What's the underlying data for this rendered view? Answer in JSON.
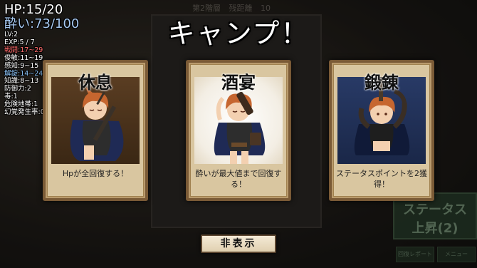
{
  "background": {
    "floor_label": "第2階層",
    "distance_label": "残距離",
    "distance_value": "10",
    "status_up_line1": "ステータス",
    "status_up_line2": "上昇(2)",
    "small_btn_1": "回復レポート",
    "small_btn_2": "メニュー"
  },
  "hud": {
    "hp": "HP:15/20",
    "drunk": "酔い:73/100",
    "lv": "LV:2",
    "exp": "EXP:5 / 7",
    "combat": "戦闘:17~29",
    "dodge": "俊敏:11~19",
    "perception": "感知:9~15",
    "unlock": "解錠:14~24",
    "knowledge": "知識:8~13",
    "defense": "防御力:2",
    "poison": "毒:1",
    "danger_zone": "危険地帯:1",
    "hallucination": "幻覚発生率:0%"
  },
  "title": "キャンプ！",
  "cards": [
    {
      "title": "休息",
      "desc": "Hpが全回復する！"
    },
    {
      "title": "酒宴",
      "desc": "酔いが最大値まで回復する！"
    },
    {
      "title": "鍛錬",
      "desc": "ステータスポイントを2獲得！"
    }
  ],
  "hide_button": "非表示",
  "colors": {
    "card_bg": "#d9c6a0",
    "card_border": "#7a5a36",
    "hud_red": "#ff6b6b",
    "hud_blue": "#8ec8ff"
  }
}
